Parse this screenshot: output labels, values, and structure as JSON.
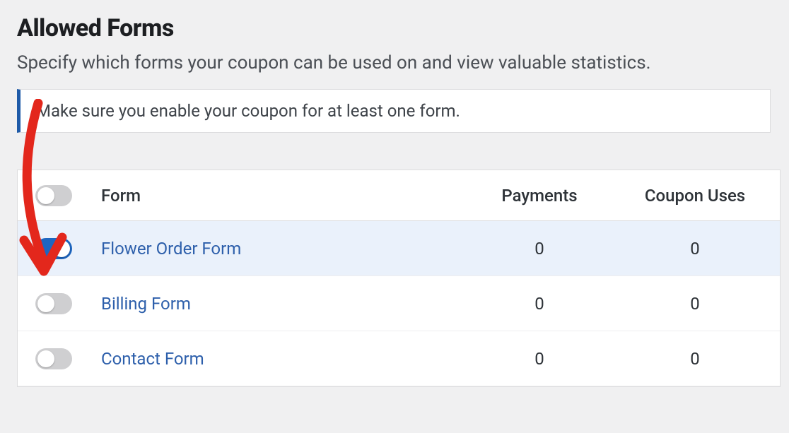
{
  "header": {
    "title": "Allowed Forms",
    "subtitle": "Specify which forms your coupon can be used on and view valuable statistics."
  },
  "notice": {
    "text": "Make sure you enable your coupon for at least one form."
  },
  "table": {
    "columns": {
      "form": "Form",
      "payments": "Payments",
      "uses": "Coupon Uses"
    },
    "rows": [
      {
        "enabled": true,
        "name": "Flower Order Form",
        "payments": "0",
        "uses": "0"
      },
      {
        "enabled": false,
        "name": "Billing Form",
        "payments": "0",
        "uses": "0"
      },
      {
        "enabled": false,
        "name": "Contact Form",
        "payments": "0",
        "uses": "0"
      }
    ]
  },
  "colors": {
    "accent": "#1e66c0",
    "link": "#2d5fab",
    "annotation": "#e3271c"
  }
}
